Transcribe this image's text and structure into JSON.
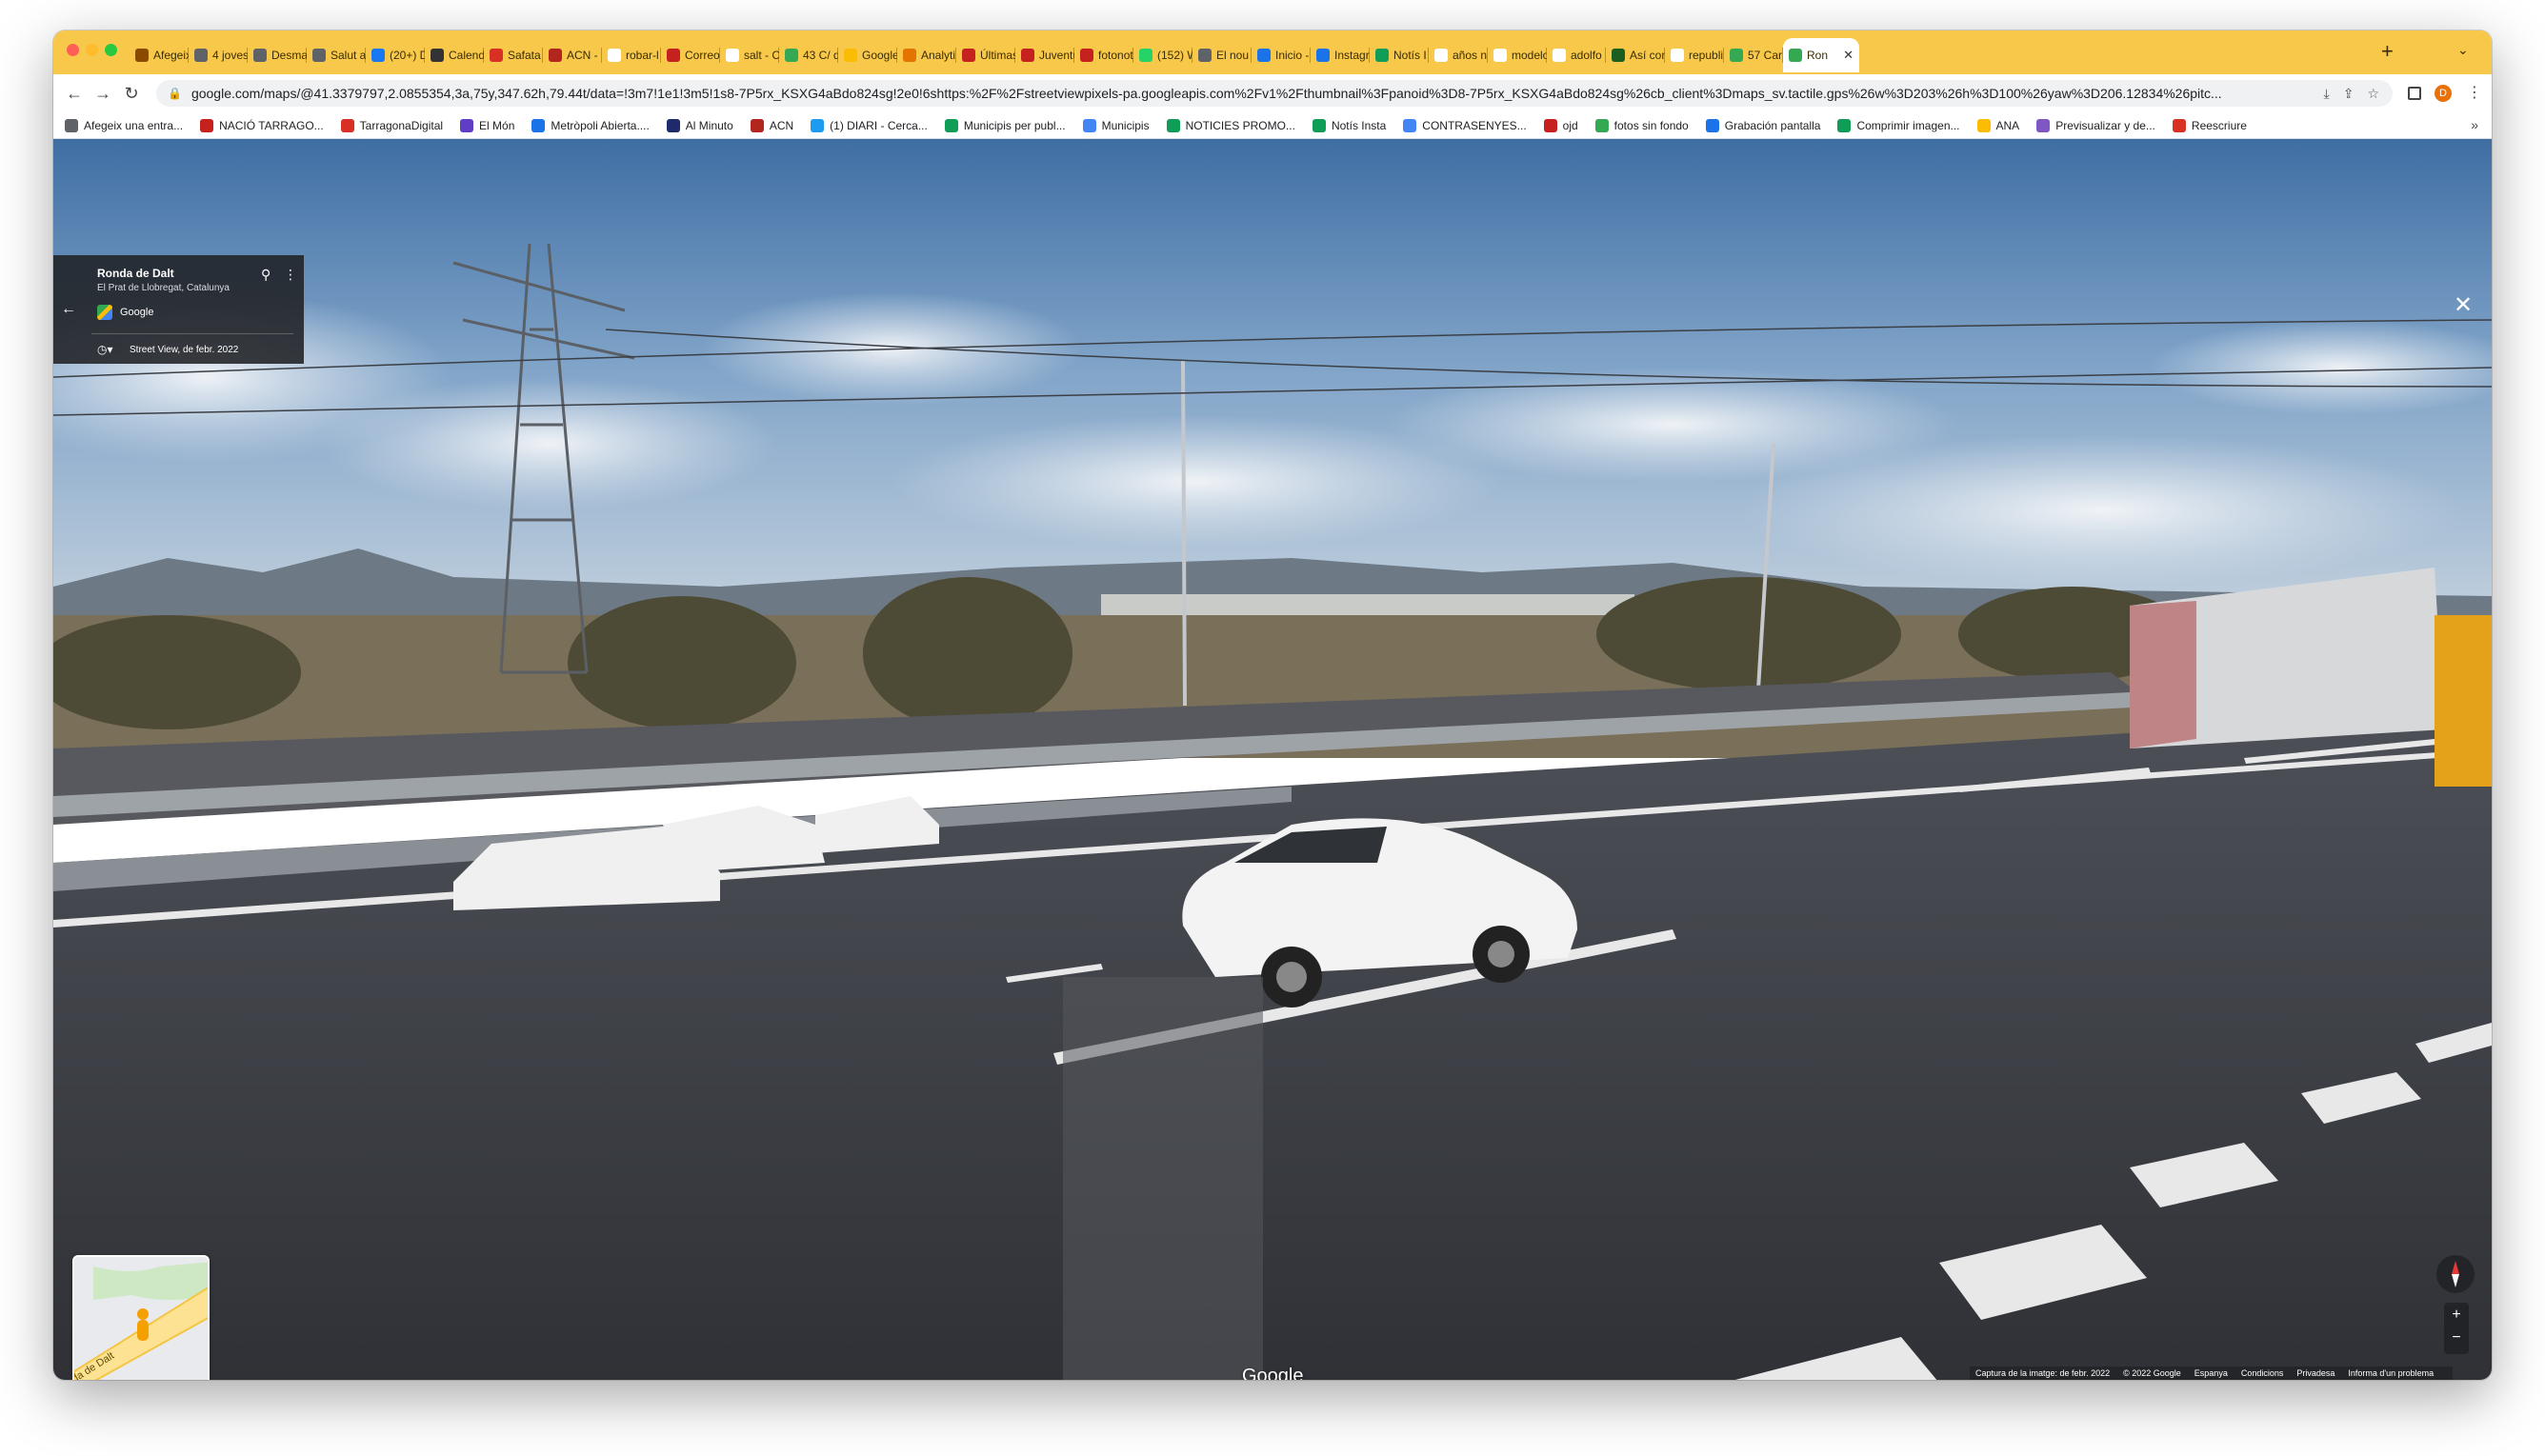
{
  "browser": {
    "tabs": [
      {
        "label": "Afegeix",
        "icon": "site-icon",
        "color": "#8a4b00"
      },
      {
        "label": "4 joves",
        "icon": "site-icon",
        "color": "#5f6368"
      },
      {
        "label": "Desmant",
        "icon": "site-icon",
        "color": "#5f6368"
      },
      {
        "label": "Salut al",
        "icon": "site-icon",
        "color": "#5f6368"
      },
      {
        "label": "(20+) D",
        "icon": "facebook-icon",
        "color": "#1877f2"
      },
      {
        "label": "Calend",
        "icon": "calendar-icon",
        "color": "#333333"
      },
      {
        "label": "Safata",
        "icon": "gmail-icon",
        "color": "#d93025"
      },
      {
        "label": "ACN -",
        "icon": "acn-icon",
        "color": "#b3261e"
      },
      {
        "label": "robar-l",
        "icon": "google-icon",
        "color": "#ffffff"
      },
      {
        "label": "Correo",
        "icon": "mail-icon",
        "color": "#c5221f"
      },
      {
        "label": "salt - C",
        "icon": "google-icon",
        "color": "#ffffff"
      },
      {
        "label": "43 C/ d",
        "icon": "maps-icon",
        "color": "#34a853"
      },
      {
        "label": "Google",
        "icon": "google-icon",
        "color": "#fbbc04"
      },
      {
        "label": "Analyti",
        "icon": "analytics-icon",
        "color": "#e37400"
      },
      {
        "label": "Últimas",
        "icon": "ep-icon",
        "color": "#c5221f"
      },
      {
        "label": "Juventu",
        "icon": "ep-icon",
        "color": "#c5221f"
      },
      {
        "label": "fotonot",
        "icon": "ep-icon",
        "color": "#c5221f"
      },
      {
        "label": "(152) W",
        "icon": "whatsapp-icon",
        "color": "#25d366"
      },
      {
        "label": "El nou",
        "icon": "site-icon",
        "color": "#5f6368"
      },
      {
        "label": "Inicio -",
        "icon": "site-icon",
        "color": "#1a73e8"
      },
      {
        "label": "Instagr",
        "icon": "site-icon",
        "color": "#1a73e8"
      },
      {
        "label": "Notís I",
        "icon": "sheets-icon",
        "color": "#0f9d58"
      },
      {
        "label": "años n",
        "icon": "google-icon",
        "color": "#ffffff"
      },
      {
        "label": "modelo",
        "icon": "google-icon",
        "color": "#ffffff"
      },
      {
        "label": "adolfo",
        "icon": "google-icon",
        "color": "#ffffff"
      },
      {
        "label": "Así com",
        "icon": "site-icon",
        "color": "#1b5e20"
      },
      {
        "label": "republi",
        "icon": "google-icon",
        "color": "#ffffff"
      },
      {
        "label": "57 Car",
        "icon": "maps-icon",
        "color": "#34a853"
      },
      {
        "label": "Ron",
        "icon": "maps-icon",
        "color": "#34a853",
        "active": true
      }
    ],
    "new_tab": "+",
    "url": "google.com/maps/@41.3379797,2.0855354,3a,75y,347.62h,79.44t/data=!3m7!1e1!3m5!1s8-7P5rx_KSXG4aBdo824sg!2e0!6shttps:%2F%2Fstreetviewpixels-pa.googleapis.com%2Fv1%2Fthumbnail%3Fpanoid%3D8-7P5rx_KSXG4aBdo824sg%26cb_client%3Dmaps_sv.tactile.gps%26w%3D203%26h%3D100%26yaw%3D206.12834%26pitc...",
    "profile_initial": "D"
  },
  "bookmarks": [
    {
      "label": "Afegeix una entra...",
      "color": "#5f6368"
    },
    {
      "label": "NACIÓ TARRAGO...",
      "color": "#c5221f"
    },
    {
      "label": "TarragonaDigital",
      "color": "#d93025"
    },
    {
      "label": "El Món",
      "color": "#5f3dc4"
    },
    {
      "label": "Metròpoli Abierta....",
      "color": "#1a73e8"
    },
    {
      "label": "Al Minuto",
      "color": "#1f2a6b"
    },
    {
      "label": "ACN",
      "color": "#b3261e"
    },
    {
      "label": "(1) DIARI - Cerca...",
      "color": "#1d9bf0"
    },
    {
      "label": "Municipis per publ...",
      "color": "#0f9d58"
    },
    {
      "label": "Municipis",
      "color": "#4285f4"
    },
    {
      "label": "NOTICIES PROMO...",
      "color": "#0f9d58"
    },
    {
      "label": "Notís Insta",
      "color": "#0f9d58"
    },
    {
      "label": "CONTRASENYES...",
      "color": "#4285f4"
    },
    {
      "label": "ojd",
      "color": "#c5221f"
    },
    {
      "label": "fotos sin fondo",
      "color": "#34a853"
    },
    {
      "label": "Grabación pantalla",
      "color": "#1a73e8"
    },
    {
      "label": "Comprimir imagen...",
      "color": "#0f9d58"
    },
    {
      "label": "ANA",
      "color": "#fbbc04"
    },
    {
      "label": "Previsualizar y de...",
      "color": "#7e57c2"
    },
    {
      "label": "Reescriure",
      "color": "#d93025"
    }
  ],
  "streetview": {
    "place_name": "Ronda de Dalt",
    "place_subtitle": "El Prat de Llobregat, Catalunya",
    "attribution": "Google",
    "capture_date": "Street View, de febr. 2022",
    "watermark": "Google",
    "minimap_road_label": "da de Dalt",
    "zoom_in": "+",
    "zoom_out": "−",
    "footer": {
      "capture": "Captura de la imatge: de febr. 2022",
      "copyright": "© 2022 Google",
      "region": "Espanya",
      "terms": "Condicions",
      "privacy": "Privadesa",
      "report": "Informa d'un problema"
    }
  }
}
